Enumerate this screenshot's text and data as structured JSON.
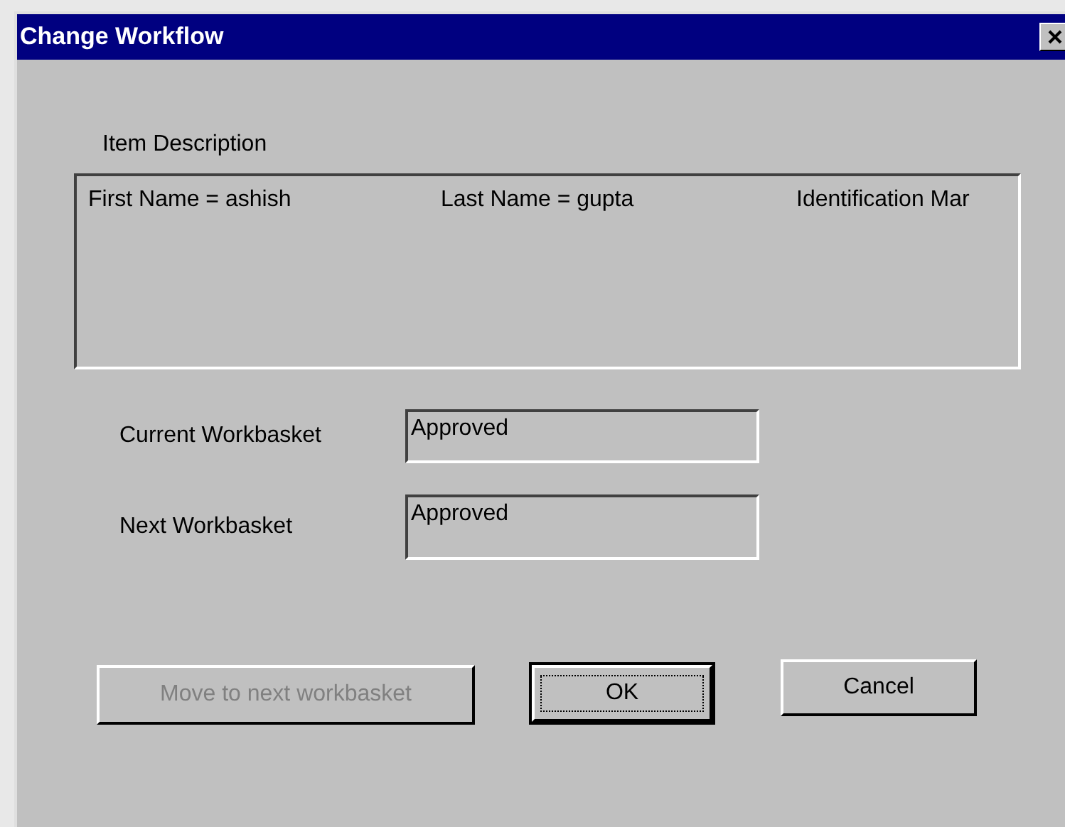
{
  "window": {
    "title": "Change Workflow"
  },
  "item_description": {
    "label": "Item Description",
    "items": [
      "First Name = ashish",
      "Last Name = gupta",
      "Identification Mar"
    ]
  },
  "fields": [
    {
      "label": "Current Workbasket",
      "value": "Approved"
    },
    {
      "label": "Next Workbasket",
      "value": "Approved"
    }
  ],
  "buttons": [
    {
      "label": "Move to next workbasket",
      "disabled": true,
      "default": false
    },
    {
      "label": "OK",
      "disabled": false,
      "default": true
    },
    {
      "label": "Cancel",
      "disabled": false,
      "default": false
    }
  ]
}
